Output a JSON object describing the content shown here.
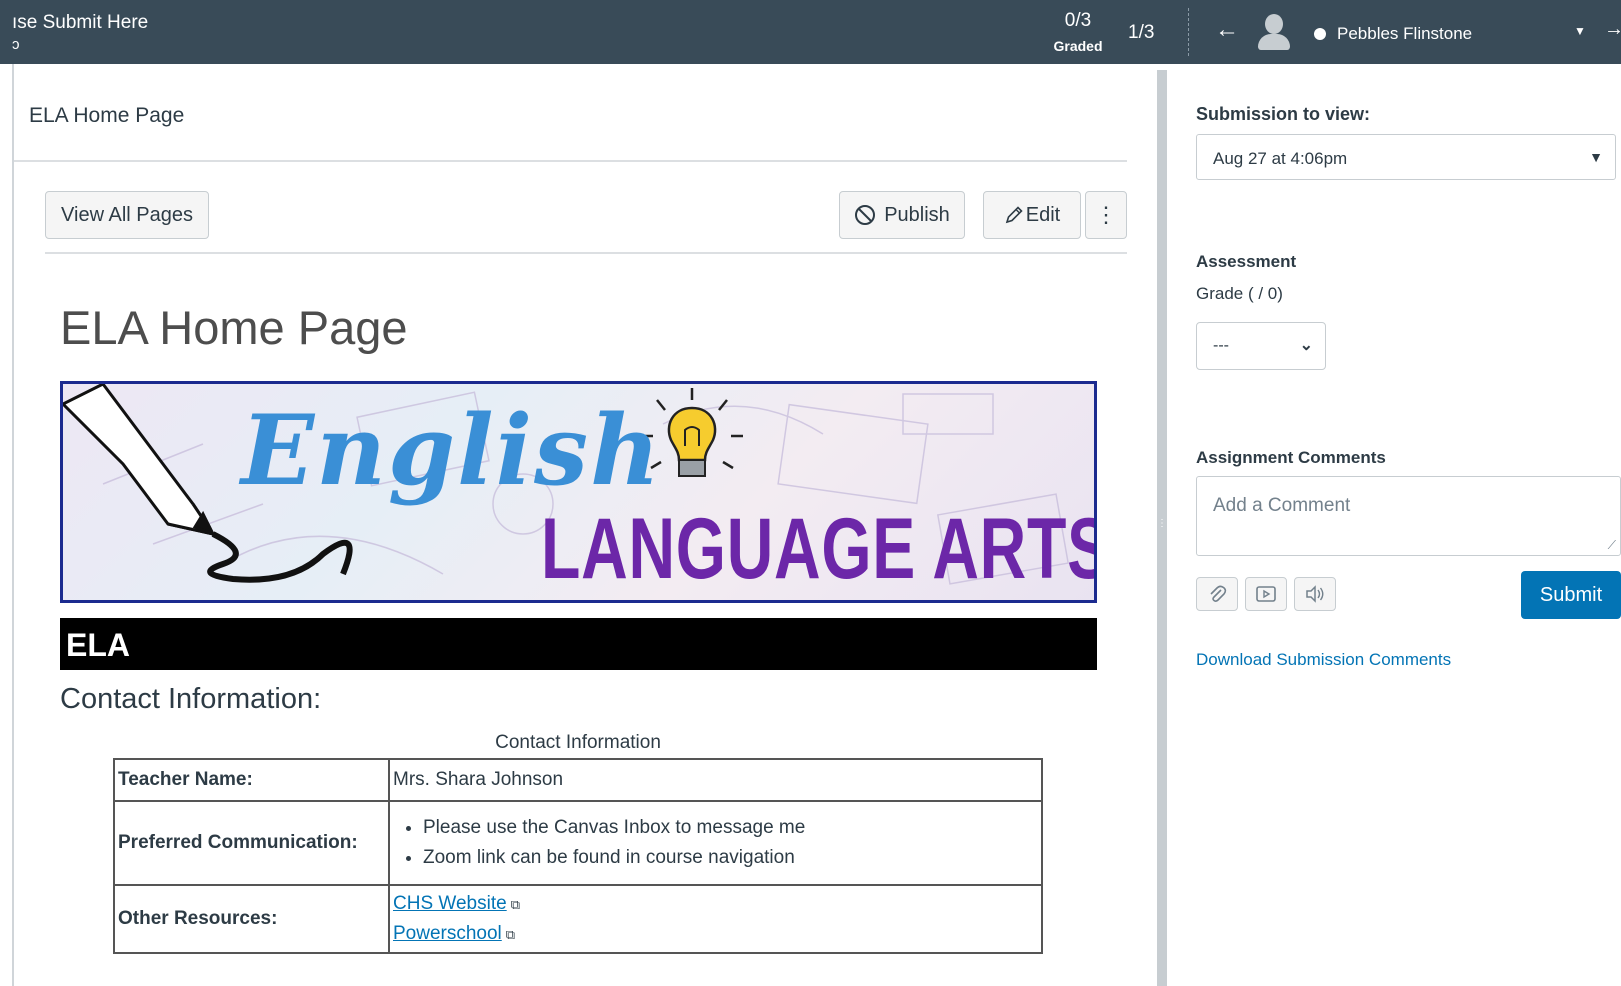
{
  "topbar": {
    "title": "ıse Submit Here",
    "title_sub": "ɔ",
    "graded_count": "0/3",
    "graded_label": "Graded",
    "student_position": "1/3",
    "back_icon": "arrow-left-icon",
    "student_name": "Pebbles Flinstone",
    "next_icon": "arrow-right-icon"
  },
  "page": {
    "breadcrumb": "ELA Home Page",
    "view_all_label": "View All Pages",
    "publish_label": "Publish",
    "edit_label": "Edit",
    "more_label": "⋮",
    "title": "ELA Home Page"
  },
  "banner": {
    "line1": "English",
    "line2": "LANGUAGE ARTS"
  },
  "content": {
    "section_bar": "ELA",
    "contact_heading": "Contact Information:",
    "table_caption": "Contact Information",
    "rows": [
      {
        "label": "Teacher Name:",
        "value": "Mrs. Shara Johnson"
      },
      {
        "label": "Preferred Communication:",
        "items": [
          "Please  use the Canvas Inbox to message me",
          "Zoom link can be found in course navigation"
        ]
      },
      {
        "label": "Other Resources:",
        "links": [
          "CHS Website",
          "Powerschool"
        ]
      }
    ]
  },
  "sidebar": {
    "submission_label": "Submission to view:",
    "submission_value": "Aug 27 at 4:06pm",
    "assessment_label": "Assessment",
    "grade_hint": "Grade ( / 0)",
    "grade_value": "---",
    "comments_label": "Assignment Comments",
    "comment_placeholder": "Add a Comment",
    "submit_label": "Submit",
    "download_label": "Download Submission Comments"
  },
  "colors": {
    "topbar": "#394b58",
    "link": "#0374b5",
    "submit": "#0374b5",
    "banner_blue": "#3a8fd6",
    "banner_purple": "#6c27a8"
  }
}
